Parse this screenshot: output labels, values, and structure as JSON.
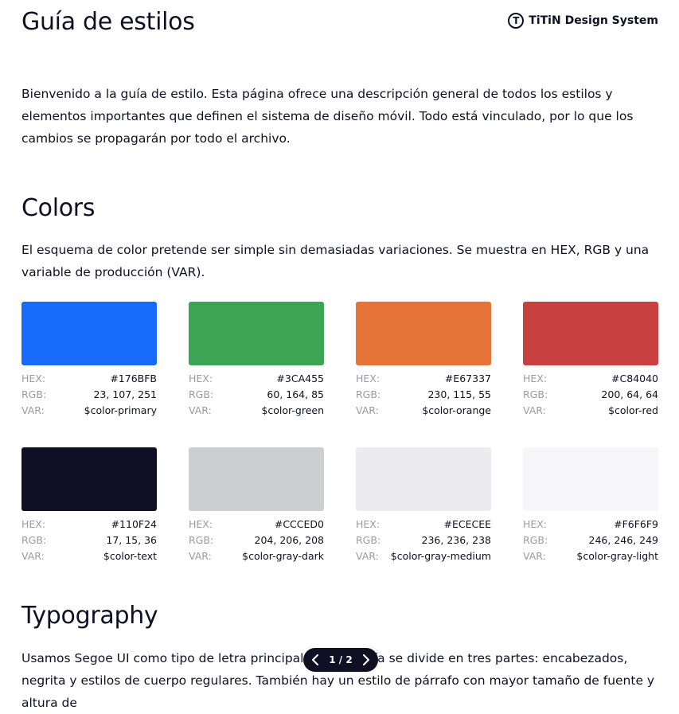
{
  "header": {
    "title": "Guía de estilos",
    "brand_logo_letter": "T",
    "brand_name": "TiTiN Design System"
  },
  "intro": "Bienvenido a la guía de estilo. Esta página ofrece una descripción general de todos los estilos y elementos importantes que definen el sistema de diseño móvil. Todo está vinculado, por lo que los cambios se propagarán por todo el archivo.",
  "colors_section": {
    "title": "Colors",
    "description": "El esquema de color pretende ser simple sin demasiadas variaciones. Se muestra en HEX, RGB y una variable de producción (VAR).",
    "labels": {
      "hex": "HEX:",
      "rgb": "RGB:",
      "var": "VAR:"
    },
    "swatches": [
      {
        "hex": "#176BFB",
        "rgb": "23, 107, 251",
        "var": "$color-primary"
      },
      {
        "hex": "#3CA455",
        "rgb": "60, 164, 85",
        "var": "$color-green"
      },
      {
        "hex": "#E67337",
        "rgb": "230, 115, 55",
        "var": "$color-orange"
      },
      {
        "hex": "#C84040",
        "rgb": "200, 64, 64",
        "var": "$color-red"
      },
      {
        "hex": "#110F24",
        "rgb": "17, 15, 36",
        "var": "$color-text"
      },
      {
        "hex": "#CCCED0",
        "rgb": "204, 206, 208",
        "var": "$color-gray-dark"
      },
      {
        "hex": "#ECECEE",
        "rgb": "236, 236, 238",
        "var": "$color-gray-medium"
      },
      {
        "hex": "#F6F6F9",
        "rgb": "246, 246, 249",
        "var": "$color-gray-light"
      }
    ]
  },
  "typography_section": {
    "title": "Typography",
    "description": "Usamos Segoe UI como tipo de letra principal. La jerarquía se divide en tres partes: encabezados, negrita y estilos de cuerpo regulares. También hay un estilo de párrafo con mayor tamaño de fuente y altura de"
  },
  "pager": {
    "label": "1 / 2"
  },
  "icons": {
    "prev": "chevron-left-icon",
    "next": "chevron-right-icon"
  }
}
